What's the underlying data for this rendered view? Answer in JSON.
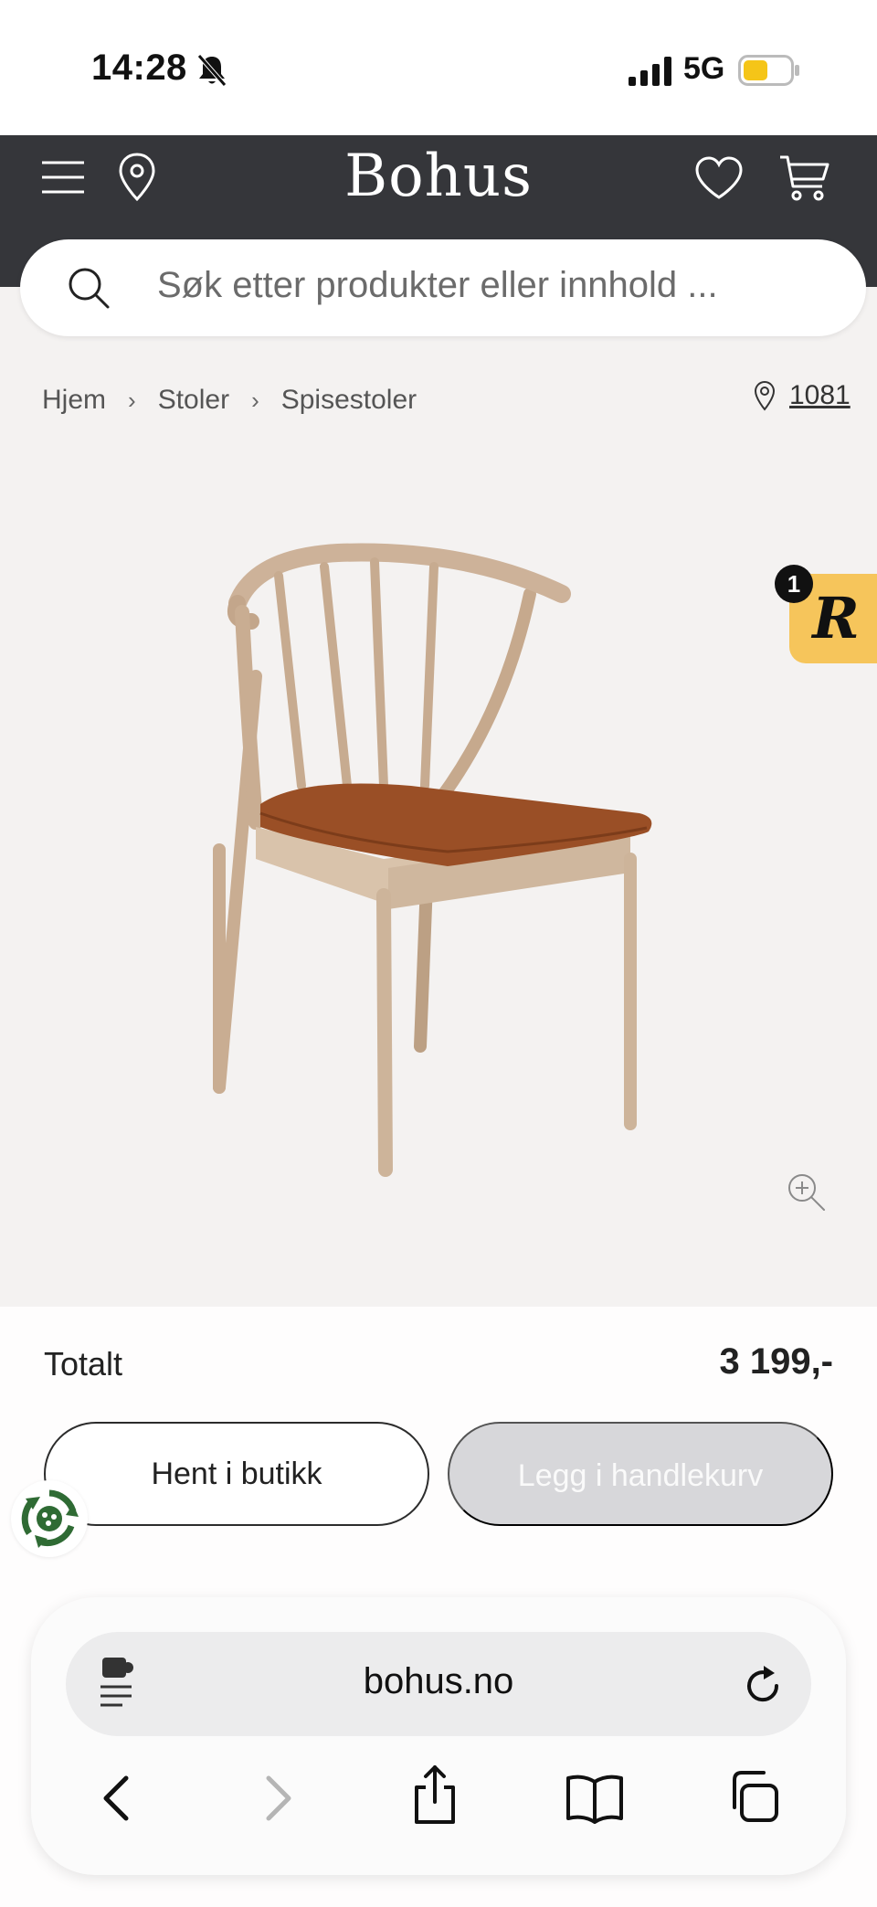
{
  "status_bar": {
    "time": "14:28",
    "network": "5G",
    "battery_color": "#f5c518"
  },
  "header": {
    "logo": "Bohus",
    "background": "#35363a"
  },
  "search": {
    "placeholder": "Søk etter produkter eller innhold ..."
  },
  "breadcrumb": {
    "items": [
      "Hjem",
      "Stoler",
      "Spisestoler"
    ]
  },
  "store": {
    "label": "1081"
  },
  "product": {
    "image_alt": "Spisestol i lys eik med brunt sete"
  },
  "badge": {
    "letter": "R",
    "count": "1",
    "color": "#f6c55b"
  },
  "checkout": {
    "total_label": "Totalt",
    "total_price": "3 199,-",
    "pickup_label": "Hent i butikk",
    "add_to_cart_label": "Legg i handlekurv"
  },
  "browser": {
    "url": "bohus.no"
  },
  "icons": {
    "mute": "bell-slash-icon",
    "menu": "hamburger-icon",
    "location": "map-pin-icon",
    "favorites": "heart-icon",
    "cart": "shopping-cart-icon",
    "search": "search-icon",
    "zoom": "zoom-in-icon",
    "eco": "recycle-icon",
    "extension": "puzzle-icon",
    "reload": "reload-icon"
  }
}
